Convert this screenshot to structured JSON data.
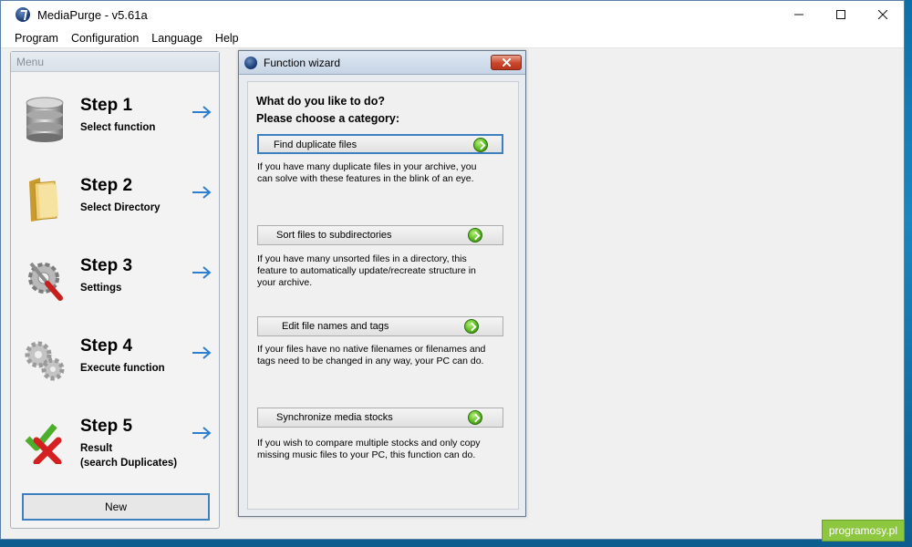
{
  "window": {
    "title": "MediaPurge - v5.61a"
  },
  "menubar": {
    "items": [
      "Program",
      "Configuration",
      "Language",
      "Help"
    ]
  },
  "menu": {
    "header": "Menu",
    "steps": [
      {
        "title": "Step 1",
        "sub1": "Select function",
        "sub2": ""
      },
      {
        "title": "Step 2",
        "sub1": "Select Directory",
        "sub2": ""
      },
      {
        "title": "Step 3",
        "sub1": "Settings",
        "sub2": ""
      },
      {
        "title": "Step 4",
        "sub1": "Execute function",
        "sub2": ""
      },
      {
        "title": "Step 5",
        "sub1": "Result",
        "sub2": "(search Duplicates)"
      }
    ],
    "new_button": "New"
  },
  "wizard": {
    "title": "Function wizard",
    "prompt_line1": "What do you like to do?",
    "prompt_line2": "Please choose a category:",
    "categories": [
      {
        "label": "Find duplicate files",
        "desc_lines": [
          "If you have many duplicate files in your archive, you",
          "can solve with these features in the blink of an eye."
        ]
      },
      {
        "label": "Sort files to subdirectories",
        "desc_lines": [
          "If you have many unsorted files in a directory, this",
          "feature to automatically update/recreate structure in",
          "your archive."
        ]
      },
      {
        "label": "Edit file names and tags",
        "desc_lines": [
          "If your files have no native filenames or filenames and",
          "tags need to be changed in any way, your PC can do."
        ]
      },
      {
        "label": "Synchronize media stocks",
        "desc_lines": [
          "If you wish to compare multiple stocks and only copy",
          "missing music files to your PC, this function can do."
        ]
      }
    ]
  },
  "watermark": "programosy.pl"
}
